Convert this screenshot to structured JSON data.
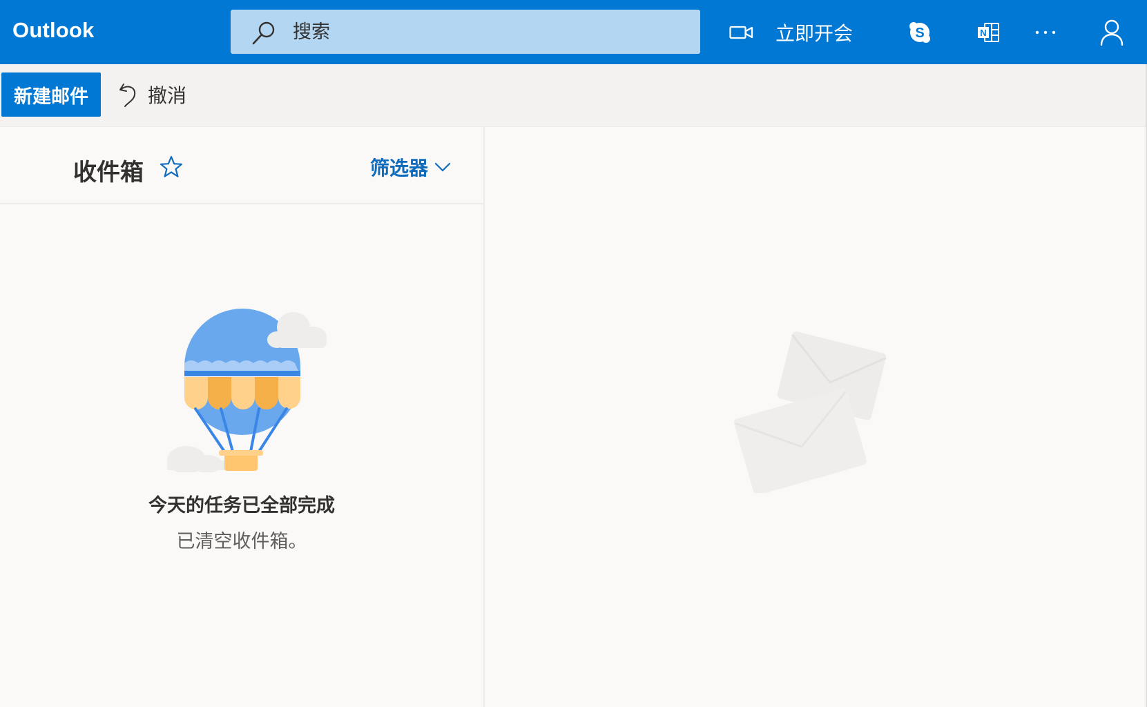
{
  "header": {
    "app_name": "Outlook",
    "search_placeholder": "搜索",
    "meet_now_label": "立即开会",
    "icons": [
      "video-camera-icon",
      "skype-icon",
      "onenote-icon",
      "more-icon",
      "person-icon"
    ]
  },
  "toolbar": {
    "new_mail_label": "新建邮件",
    "undo_label": "撤消"
  },
  "folder": {
    "title": "收件箱",
    "filter_label": "筛选器"
  },
  "empty_state": {
    "title": "今天的任务已全部完成",
    "subtitle": "已清空收件箱。"
  },
  "colors": {
    "brand": "#0078d4",
    "search_bg": "#b3d6f2",
    "link": "#0f6cbd",
    "background": "#faf9f8"
  }
}
